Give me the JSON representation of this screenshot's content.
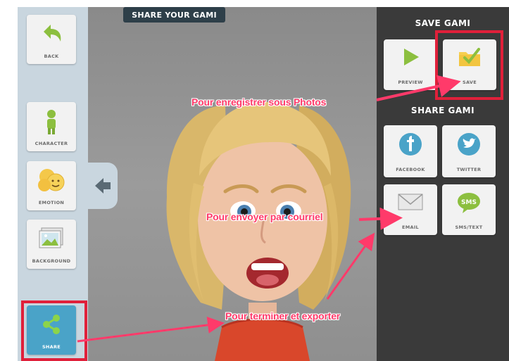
{
  "left_rail": {
    "back_label": "BACK",
    "character_label": "CHARACTER",
    "emotion_label": "EMOTION",
    "background_label": "BACKGROUND",
    "share_label": "SHARE"
  },
  "stage": {
    "title": "SHARE YOUR GAMI"
  },
  "right_panel": {
    "save_title": "SAVE GAMI",
    "preview_label": "PREVIEW",
    "save_label": "SAVE",
    "share_title": "SHARE GAMI",
    "facebook_label": "FACEBOOK",
    "twitter_label": "TWITTER",
    "email_label": "EMAIL",
    "sms_label": "SMS/TEXT",
    "sms_icon_text": "SMS"
  },
  "annotations": {
    "save_note": "Pour enregistrer sous Photos",
    "email_note": "Pour envoyer par courriel",
    "share_note": "Pour terminer et exporter"
  },
  "colors": {
    "annotation": "#ff3a6a",
    "highlight_box": "#e0203a",
    "share_tile": "#4aa3c8",
    "panel_bg": "#3a3a3a",
    "rail_bg": "#c9d6df"
  }
}
